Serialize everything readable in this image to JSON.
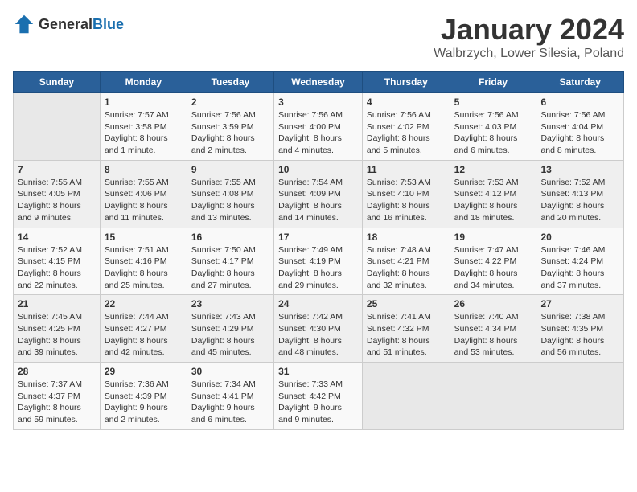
{
  "logo": {
    "text_general": "General",
    "text_blue": "Blue"
  },
  "title": "January 2024",
  "subtitle": "Walbrzych, Lower Silesia, Poland",
  "days_of_week": [
    "Sunday",
    "Monday",
    "Tuesday",
    "Wednesday",
    "Thursday",
    "Friday",
    "Saturday"
  ],
  "weeks": [
    [
      {
        "day": "",
        "sunrise": "",
        "sunset": "",
        "daylight": ""
      },
      {
        "day": "1",
        "sunrise": "Sunrise: 7:57 AM",
        "sunset": "Sunset: 3:58 PM",
        "daylight": "Daylight: 8 hours and 1 minute."
      },
      {
        "day": "2",
        "sunrise": "Sunrise: 7:56 AM",
        "sunset": "Sunset: 3:59 PM",
        "daylight": "Daylight: 8 hours and 2 minutes."
      },
      {
        "day": "3",
        "sunrise": "Sunrise: 7:56 AM",
        "sunset": "Sunset: 4:00 PM",
        "daylight": "Daylight: 8 hours and 4 minutes."
      },
      {
        "day": "4",
        "sunrise": "Sunrise: 7:56 AM",
        "sunset": "Sunset: 4:02 PM",
        "daylight": "Daylight: 8 hours and 5 minutes."
      },
      {
        "day": "5",
        "sunrise": "Sunrise: 7:56 AM",
        "sunset": "Sunset: 4:03 PM",
        "daylight": "Daylight: 8 hours and 6 minutes."
      },
      {
        "day": "6",
        "sunrise": "Sunrise: 7:56 AM",
        "sunset": "Sunset: 4:04 PM",
        "daylight": "Daylight: 8 hours and 8 minutes."
      }
    ],
    [
      {
        "day": "7",
        "sunrise": "Sunrise: 7:55 AM",
        "sunset": "Sunset: 4:05 PM",
        "daylight": "Daylight: 8 hours and 9 minutes."
      },
      {
        "day": "8",
        "sunrise": "Sunrise: 7:55 AM",
        "sunset": "Sunset: 4:06 PM",
        "daylight": "Daylight: 8 hours and 11 minutes."
      },
      {
        "day": "9",
        "sunrise": "Sunrise: 7:55 AM",
        "sunset": "Sunset: 4:08 PM",
        "daylight": "Daylight: 8 hours and 13 minutes."
      },
      {
        "day": "10",
        "sunrise": "Sunrise: 7:54 AM",
        "sunset": "Sunset: 4:09 PM",
        "daylight": "Daylight: 8 hours and 14 minutes."
      },
      {
        "day": "11",
        "sunrise": "Sunrise: 7:53 AM",
        "sunset": "Sunset: 4:10 PM",
        "daylight": "Daylight: 8 hours and 16 minutes."
      },
      {
        "day": "12",
        "sunrise": "Sunrise: 7:53 AM",
        "sunset": "Sunset: 4:12 PM",
        "daylight": "Daylight: 8 hours and 18 minutes."
      },
      {
        "day": "13",
        "sunrise": "Sunrise: 7:52 AM",
        "sunset": "Sunset: 4:13 PM",
        "daylight": "Daylight: 8 hours and 20 minutes."
      }
    ],
    [
      {
        "day": "14",
        "sunrise": "Sunrise: 7:52 AM",
        "sunset": "Sunset: 4:15 PM",
        "daylight": "Daylight: 8 hours and 22 minutes."
      },
      {
        "day": "15",
        "sunrise": "Sunrise: 7:51 AM",
        "sunset": "Sunset: 4:16 PM",
        "daylight": "Daylight: 8 hours and 25 minutes."
      },
      {
        "day": "16",
        "sunrise": "Sunrise: 7:50 AM",
        "sunset": "Sunset: 4:17 PM",
        "daylight": "Daylight: 8 hours and 27 minutes."
      },
      {
        "day": "17",
        "sunrise": "Sunrise: 7:49 AM",
        "sunset": "Sunset: 4:19 PM",
        "daylight": "Daylight: 8 hours and 29 minutes."
      },
      {
        "day": "18",
        "sunrise": "Sunrise: 7:48 AM",
        "sunset": "Sunset: 4:21 PM",
        "daylight": "Daylight: 8 hours and 32 minutes."
      },
      {
        "day": "19",
        "sunrise": "Sunrise: 7:47 AM",
        "sunset": "Sunset: 4:22 PM",
        "daylight": "Daylight: 8 hours and 34 minutes."
      },
      {
        "day": "20",
        "sunrise": "Sunrise: 7:46 AM",
        "sunset": "Sunset: 4:24 PM",
        "daylight": "Daylight: 8 hours and 37 minutes."
      }
    ],
    [
      {
        "day": "21",
        "sunrise": "Sunrise: 7:45 AM",
        "sunset": "Sunset: 4:25 PM",
        "daylight": "Daylight: 8 hours and 39 minutes."
      },
      {
        "day": "22",
        "sunrise": "Sunrise: 7:44 AM",
        "sunset": "Sunset: 4:27 PM",
        "daylight": "Daylight: 8 hours and 42 minutes."
      },
      {
        "day": "23",
        "sunrise": "Sunrise: 7:43 AM",
        "sunset": "Sunset: 4:29 PM",
        "daylight": "Daylight: 8 hours and 45 minutes."
      },
      {
        "day": "24",
        "sunrise": "Sunrise: 7:42 AM",
        "sunset": "Sunset: 4:30 PM",
        "daylight": "Daylight: 8 hours and 48 minutes."
      },
      {
        "day": "25",
        "sunrise": "Sunrise: 7:41 AM",
        "sunset": "Sunset: 4:32 PM",
        "daylight": "Daylight: 8 hours and 51 minutes."
      },
      {
        "day": "26",
        "sunrise": "Sunrise: 7:40 AM",
        "sunset": "Sunset: 4:34 PM",
        "daylight": "Daylight: 8 hours and 53 minutes."
      },
      {
        "day": "27",
        "sunrise": "Sunrise: 7:38 AM",
        "sunset": "Sunset: 4:35 PM",
        "daylight": "Daylight: 8 hours and 56 minutes."
      }
    ],
    [
      {
        "day": "28",
        "sunrise": "Sunrise: 7:37 AM",
        "sunset": "Sunset: 4:37 PM",
        "daylight": "Daylight: 8 hours and 59 minutes."
      },
      {
        "day": "29",
        "sunrise": "Sunrise: 7:36 AM",
        "sunset": "Sunset: 4:39 PM",
        "daylight": "Daylight: 9 hours and 2 minutes."
      },
      {
        "day": "30",
        "sunrise": "Sunrise: 7:34 AM",
        "sunset": "Sunset: 4:41 PM",
        "daylight": "Daylight: 9 hours and 6 minutes."
      },
      {
        "day": "31",
        "sunrise": "Sunrise: 7:33 AM",
        "sunset": "Sunset: 4:42 PM",
        "daylight": "Daylight: 9 hours and 9 minutes."
      },
      {
        "day": "",
        "sunrise": "",
        "sunset": "",
        "daylight": ""
      },
      {
        "day": "",
        "sunrise": "",
        "sunset": "",
        "daylight": ""
      },
      {
        "day": "",
        "sunrise": "",
        "sunset": "",
        "daylight": ""
      }
    ]
  ]
}
